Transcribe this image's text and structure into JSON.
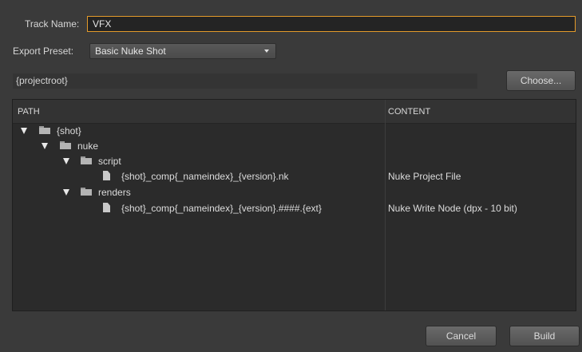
{
  "form": {
    "track_label": "Track Name:",
    "track_value": "VFX",
    "preset_label": "Export Preset:",
    "preset_value": "Basic Nuke Shot",
    "root_path": "{projectroot}",
    "choose_label": "Choose..."
  },
  "tree": {
    "headers": {
      "path": "PATH",
      "content": "CONTENT"
    },
    "rows": [
      {
        "label": "{shot}",
        "content": "",
        "type": "folder"
      },
      {
        "label": "nuke",
        "content": "",
        "type": "folder"
      },
      {
        "label": "script",
        "content": "",
        "type": "folder"
      },
      {
        "label": "{shot}_comp{_nameindex}_{version}.nk",
        "content": "Nuke Project File",
        "type": "file"
      },
      {
        "label": "renders",
        "content": "",
        "type": "folder"
      },
      {
        "label": "{shot}_comp{_nameindex}_{version}.####.{ext}",
        "content": "Nuke Write Node (dpx - 10 bit)",
        "type": "file"
      }
    ]
  },
  "footer": {
    "cancel_label": "Cancel",
    "build_label": "Build"
  },
  "colors": {
    "accent": "#e39a2a",
    "background": "#3a3a3a",
    "panel": "#2b2b2b"
  },
  "icons": {
    "expand": "triangle-down-icon",
    "folder": "folder-icon",
    "file": "file-icon",
    "dropdown": "chevron-down-icon"
  }
}
